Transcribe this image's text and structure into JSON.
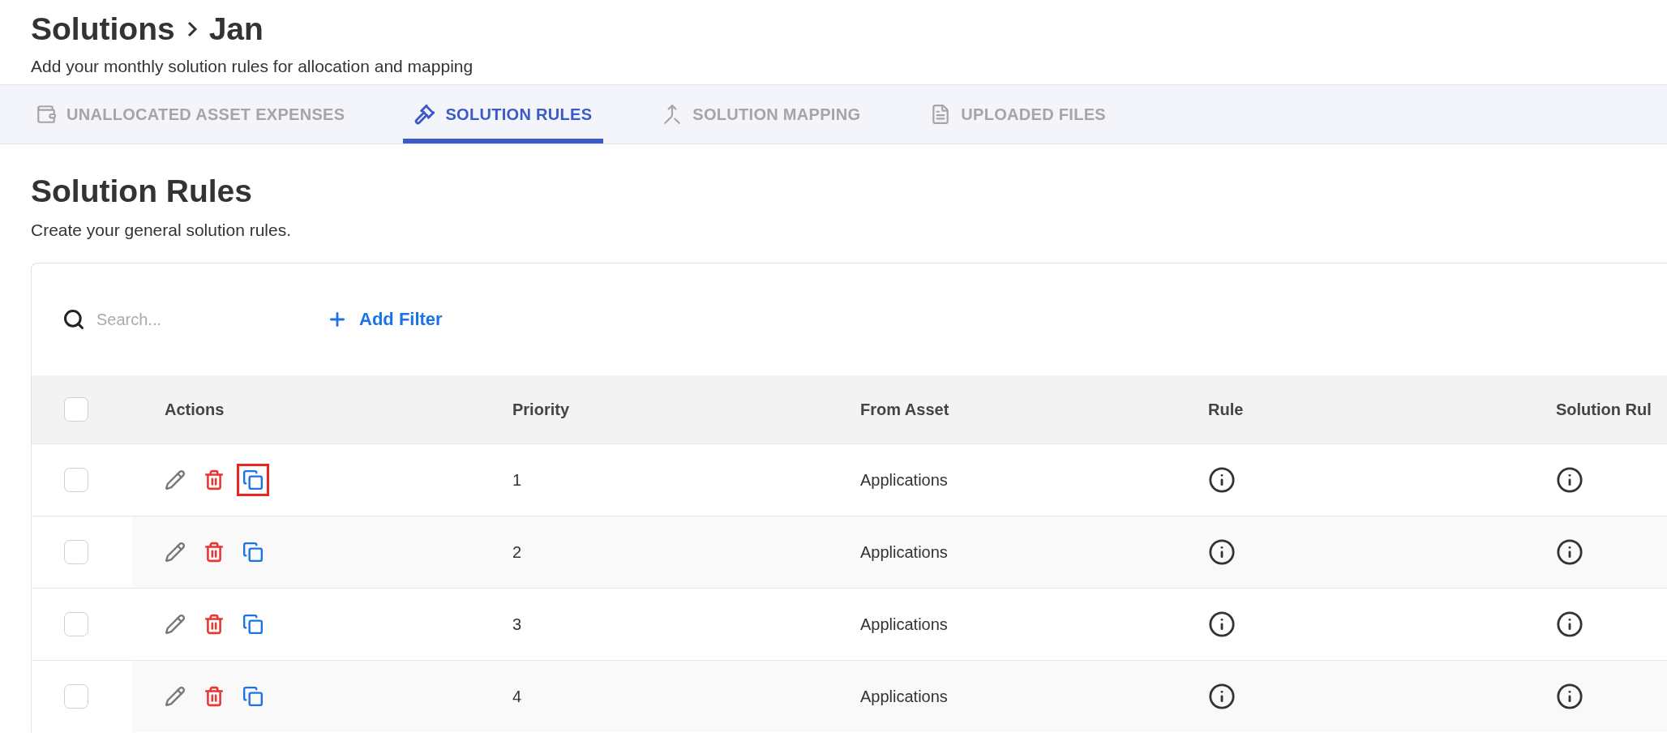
{
  "header": {
    "title": "Solutions",
    "crumb": "Jan",
    "subtitle": "Add your monthly solution rules for allocation and mapping"
  },
  "tabs": [
    {
      "label": "UNALLOCATED ASSET EXPENSES",
      "selected": false
    },
    {
      "label": "SOLUTION RULES",
      "selected": true
    },
    {
      "label": "SOLUTION MAPPING",
      "selected": false
    },
    {
      "label": "UPLOADED FILES",
      "selected": false
    }
  ],
  "section": {
    "title": "Solution Rules",
    "subtitle": "Create your general solution rules."
  },
  "toolbar": {
    "search": {
      "placeholder": "Search..."
    },
    "add_filter": "Add Filter"
  },
  "table": {
    "select_all": {
      "checked": false
    },
    "columns": [
      "Actions",
      "Priority",
      "From Asset",
      "Rule",
      "Solution Rul"
    ],
    "rows": [
      {
        "checked": false,
        "copy_highlighted": true,
        "priority": "1",
        "from_asset": "Applications"
      },
      {
        "checked": false,
        "copy_highlighted": false,
        "priority": "2",
        "from_asset": "Applications"
      },
      {
        "checked": false,
        "copy_highlighted": false,
        "priority": "3",
        "from_asset": "Applications"
      },
      {
        "checked": false,
        "copy_highlighted": false,
        "priority": "4",
        "from_asset": "Applications"
      }
    ]
  }
}
